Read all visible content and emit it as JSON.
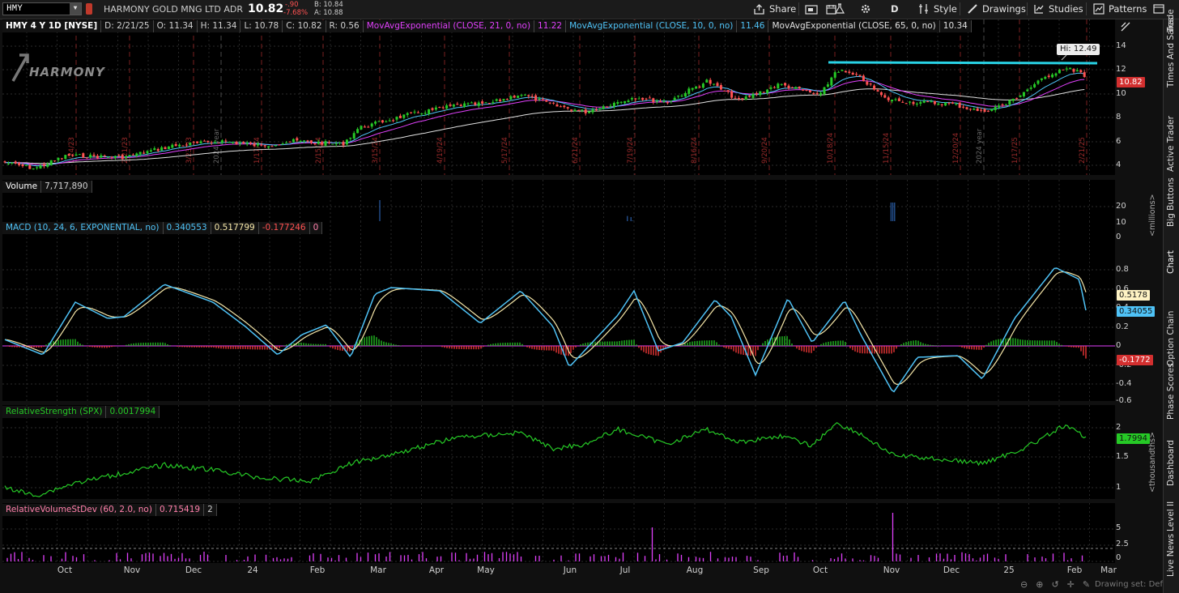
{
  "toolbar": {
    "symbol": "HMY",
    "company": "HARMONY GOLD MNG LTD ADR",
    "last": "10.82",
    "change": "-.90",
    "change_pct": "-7.68%",
    "bid": "B: 10.84",
    "ask": "A: 10.88",
    "share": "Share",
    "period": "D",
    "style": "Style",
    "drawings": "Drawings",
    "studies": "Studies",
    "patterns": "Patterns"
  },
  "price_panel": {
    "title": "HMY 4 Y 1D [NYSE]",
    "date": "D: 2/21/25",
    "open": "O: 11.34",
    "high": "H: 11.34",
    "low": "L: 10.78",
    "close": "C: 10.82",
    "range": "R: 0.56",
    "ma1": "MovAvgExponential (CLOSE, 21, 0, no)",
    "ma1_val": "11.22",
    "ma2": "MovAvgExponential (CLOSE, 10, 0, no)",
    "ma2_val": "11.46",
    "ma3": "MovAvgExponential (CLOSE, 65, 0, no)",
    "ma3_val": "10.34",
    "hi_label": "Hi: 12.49",
    "last_tag": "10.82",
    "logo": "HARMONY",
    "axis": [
      "14",
      "12",
      "10",
      "8",
      "6",
      "4"
    ],
    "date_marks": [
      "1/24/23",
      "2/21/23",
      "3/23/23",
      "2024 year",
      "1/17/24",
      "2/15/24",
      "3/15/24",
      "4/19/24",
      "5/17/24",
      "6/21/24",
      "7/19/24",
      "8/16/24",
      "9/20/24",
      "10/18/24",
      "11/15/24",
      "12/20/24",
      "2024 year",
      "1/17/25",
      "2/21/25"
    ],
    "colors": {
      "ma_fast": "#4fc3f7",
      "ma_mid": "#e040fb",
      "ma_slow": "#e0e0e0",
      "resistance": "#29d3e6",
      "up": "#26c926",
      "down": "#ff5252"
    }
  },
  "volume_panel": {
    "title": "Volume",
    "value": "7,717,890",
    "axis": [
      "20",
      "10",
      "0"
    ],
    "unit": "<millions>"
  },
  "macd_panel": {
    "title": "MACD (10, 24, 6, EXPONENTIAL, no)",
    "macd": "0.340553",
    "signal": "0.517799",
    "hist": "-0.177246",
    "flag": "0",
    "axis": [
      "0.8",
      "0.6",
      "0.4",
      "0.2",
      "0",
      "-0.2",
      "-0.4",
      "-0.6"
    ],
    "tag_signal": "0.5178",
    "tag_macd": "0.34055",
    "tag_hist": "-0.1772"
  },
  "rs_panel": {
    "title": "RelativeStrength (SPX)",
    "value": "0.0017994",
    "axis": [
      "2",
      "1.5",
      "1"
    ],
    "tag": "1.7994",
    "unit": "<thousandths>"
  },
  "rv_panel": {
    "title": "RelativeVolumeStDev (60, 2.0, no)",
    "value": "0.715419",
    "flag": "2",
    "axis": [
      "5",
      "2.5",
      "0"
    ]
  },
  "x_axis": [
    "Oct",
    "Nov",
    "Dec",
    "24",
    "Feb",
    "Mar",
    "Apr",
    "May",
    "Jun",
    "Jul",
    "Aug",
    "Sep",
    "Oct",
    "Nov",
    "Dec",
    "25",
    "Feb",
    "Mar"
  ],
  "drawing_set": "Drawing set: Default",
  "sidebar": [
    "Trade",
    "Times And Sales",
    "Active Trader",
    "Big Buttons",
    "Chart",
    "Option Chain",
    "Phase Scores",
    "Dashboard",
    "Level II",
    "Live News"
  ]
}
